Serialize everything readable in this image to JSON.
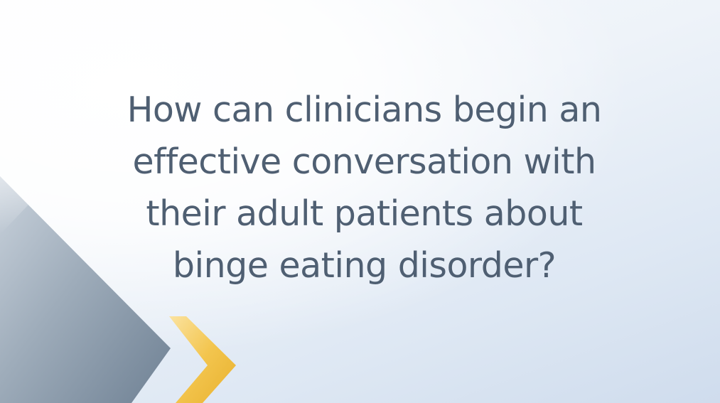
{
  "slide": {
    "question": "How can clinicians begin an effective conversation with their adult patients about binge eating disorder?",
    "colors": {
      "text": "#4f5f72",
      "triangle": "#8a99a9",
      "chevron": "#f2c94c",
      "background": "#eef3f9"
    }
  }
}
